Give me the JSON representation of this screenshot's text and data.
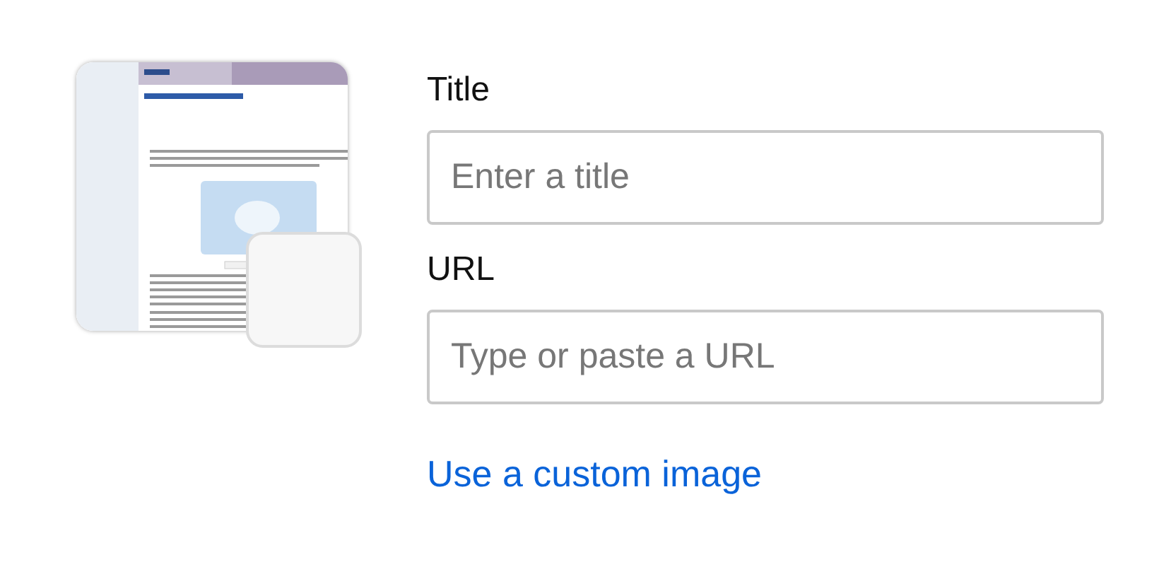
{
  "fields": [
    {
      "label": "Title",
      "placeholder": "Enter a title"
    },
    {
      "label": "URL",
      "placeholder": "Type or paste a URL"
    }
  ],
  "link": "Use a custom image"
}
